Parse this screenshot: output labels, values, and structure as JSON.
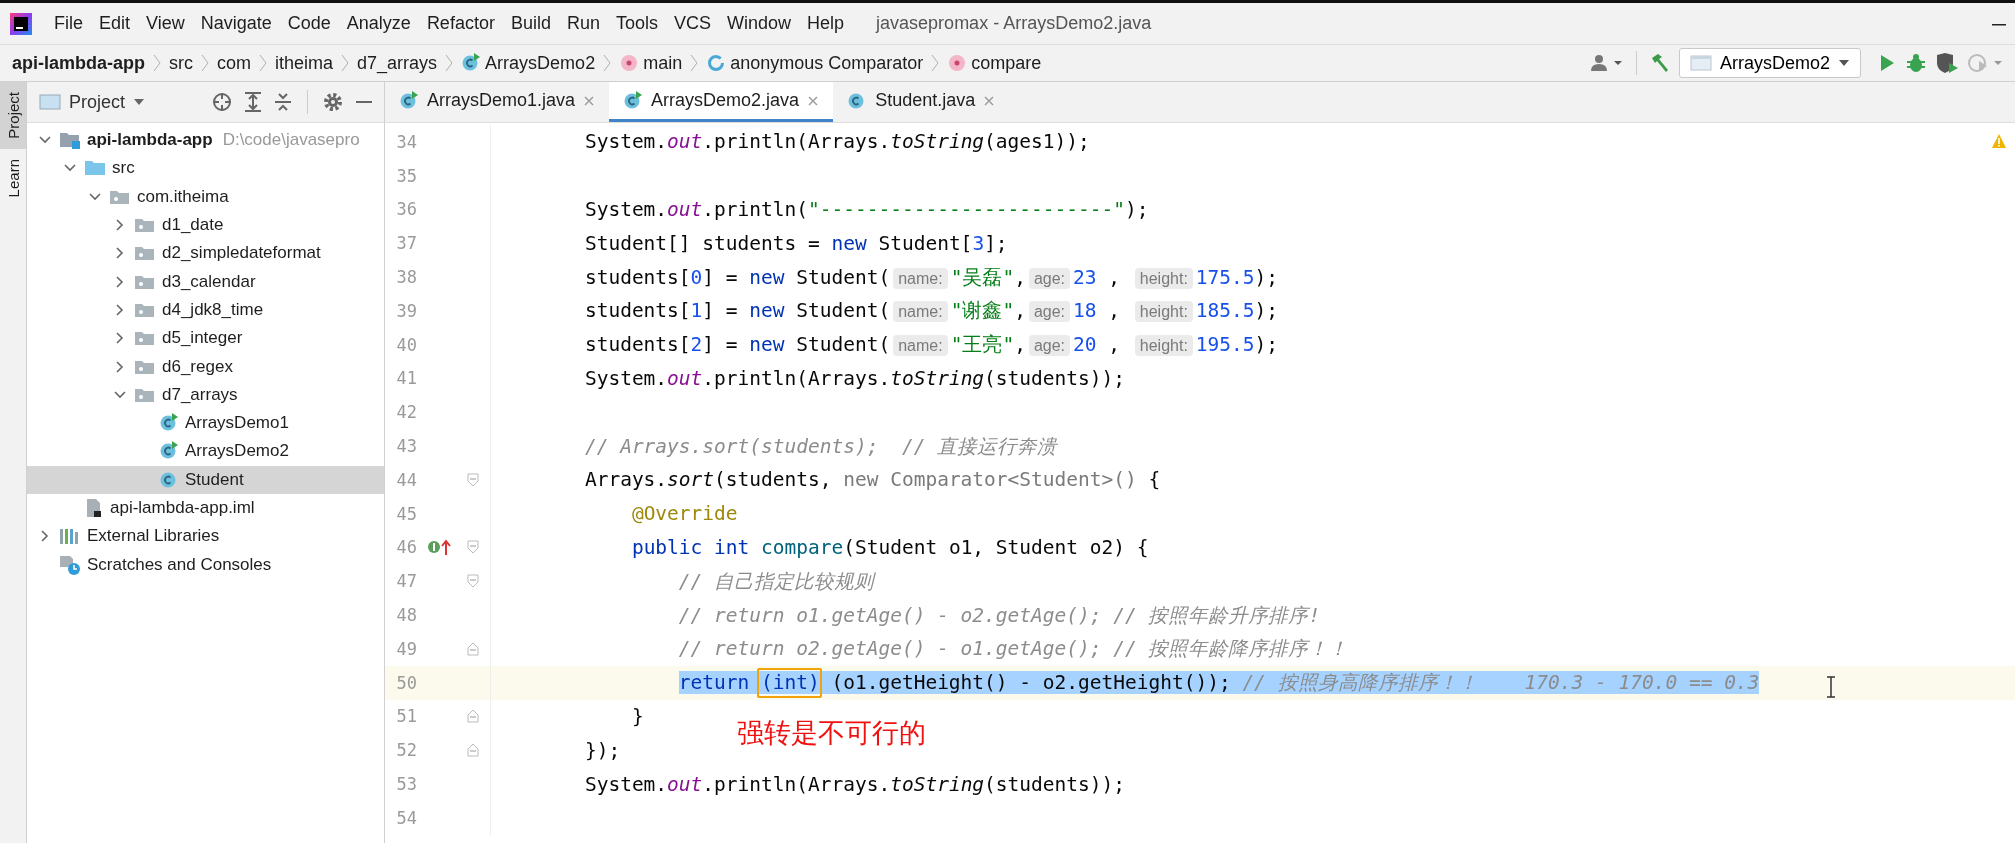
{
  "title_bar": {
    "menu": [
      "File",
      "Edit",
      "View",
      "Navigate",
      "Code",
      "Analyze",
      "Refactor",
      "Build",
      "Run",
      "Tools",
      "VCS",
      "Window",
      "Help"
    ],
    "title": "javasepromax - ArraysDemo2.java"
  },
  "nav_bar": {
    "breadcrumbs": [
      {
        "label": "api-lambda-app"
      },
      {
        "label": "src"
      },
      {
        "label": "com"
      },
      {
        "label": "itheima"
      },
      {
        "label": "d7_arrays"
      },
      {
        "label": "ArraysDemo2",
        "kind": "class-run"
      },
      {
        "label": "main",
        "kind": "method"
      },
      {
        "label": "anonymous Comparator",
        "kind": "anonymous"
      },
      {
        "label": "compare",
        "kind": "method"
      }
    ],
    "run_config": "ArraysDemo2"
  },
  "stripe_tabs": [
    {
      "label": "Project",
      "selected": true
    },
    {
      "label": "Learn",
      "selected": false
    }
  ],
  "project_panel": {
    "title": "Project",
    "tree": [
      {
        "label": "api-lambda-app",
        "kind": "module",
        "hint": "D:\\code\\javasepro",
        "expanded": true,
        "selected": false,
        "children": [
          {
            "label": "src",
            "kind": "folder-src",
            "expanded": true,
            "selected": false,
            "children": [
              {
                "label": "com.itheima",
                "kind": "package",
                "expanded": true,
                "selected": false,
                "children": [
                  {
                    "label": "d1_date",
                    "kind": "package",
                    "expanded": false,
                    "selected": false
                  },
                  {
                    "label": "d2_simpledateformat",
                    "kind": "package",
                    "expanded": false,
                    "selected": false
                  },
                  {
                    "label": "d3_calendar",
                    "kind": "package",
                    "expanded": false,
                    "selected": false
                  },
                  {
                    "label": "d4_jdk8_time",
                    "kind": "package",
                    "expanded": false,
                    "selected": false
                  },
                  {
                    "label": "d5_integer",
                    "kind": "package",
                    "expanded": false,
                    "selected": false
                  },
                  {
                    "label": "d6_regex",
                    "kind": "package",
                    "expanded": false,
                    "selected": false
                  },
                  {
                    "label": "d7_arrays",
                    "kind": "package",
                    "expanded": true,
                    "selected": false,
                    "children": [
                      {
                        "label": "ArraysDemo1",
                        "kind": "class-run",
                        "selected": false
                      },
                      {
                        "label": "ArraysDemo2",
                        "kind": "class-run",
                        "selected": false
                      },
                      {
                        "label": "Student",
                        "kind": "class",
                        "selected": true
                      }
                    ]
                  }
                ]
              }
            ]
          },
          {
            "label": "api-lambda-app.iml",
            "kind": "iml",
            "selected": false
          }
        ]
      },
      {
        "label": "External Libraries",
        "kind": "libraries",
        "expanded": false,
        "selected": false
      },
      {
        "label": "Scratches and Consoles",
        "kind": "scratches",
        "selected": false
      }
    ]
  },
  "editor": {
    "tabs": [
      {
        "label": "ArraysDemo1.java",
        "kind": "class-run",
        "selected": false
      },
      {
        "label": "ArraysDemo2.java",
        "kind": "class-run",
        "selected": true
      },
      {
        "label": "Student.java",
        "kind": "class",
        "selected": false
      }
    ],
    "lines": [
      {
        "no": "34",
        "tokens": [
          {
            "t": "        System.",
            "kind": "plain"
          },
          {
            "t": "out",
            "kind": "field"
          },
          {
            "t": ".println(Arrays.",
            "kind": "plain"
          },
          {
            "t": "toString",
            "kind": "static"
          },
          {
            "t": "(ages1));",
            "kind": "plain"
          }
        ]
      },
      {
        "no": "35"
      },
      {
        "no": "36",
        "tokens": [
          {
            "t": "        System.",
            "kind": "plain"
          },
          {
            "t": "out",
            "kind": "field"
          },
          {
            "t": ".println(",
            "kind": "plain"
          },
          {
            "t": "\"-------------------------\"",
            "kind": "string"
          },
          {
            "t": ");",
            "kind": "plain"
          }
        ]
      },
      {
        "no": "37",
        "tokens": [
          {
            "t": "        Student[] students = ",
            "kind": "plain"
          },
          {
            "t": "new",
            "kind": "keyword"
          },
          {
            "t": " Student[",
            "kind": "plain"
          },
          {
            "t": "3",
            "kind": "number"
          },
          {
            "t": "];",
            "kind": "plain"
          }
        ]
      },
      {
        "no": "38",
        "tokens": [
          {
            "t": "        students[",
            "kind": "plain"
          },
          {
            "t": "0",
            "kind": "number"
          },
          {
            "t": "] = ",
            "kind": "plain"
          },
          {
            "t": "new",
            "kind": "keyword"
          },
          {
            "t": " Student(",
            "kind": "plain"
          },
          {
            "t": "name:",
            "kind": "hint"
          },
          {
            "t": "\"吴磊\"",
            "kind": "string"
          },
          {
            "t": ",",
            "kind": "plain"
          },
          {
            "t": "age:",
            "kind": "hint"
          },
          {
            "t": "23",
            "kind": "number"
          },
          {
            "t": " , ",
            "kind": "plain"
          },
          {
            "t": "height:",
            "kind": "hint"
          },
          {
            "t": "175.5",
            "kind": "number"
          },
          {
            "t": ");",
            "kind": "plain"
          }
        ]
      },
      {
        "no": "39",
        "tokens": [
          {
            "t": "        students[",
            "kind": "plain"
          },
          {
            "t": "1",
            "kind": "number"
          },
          {
            "t": "] = ",
            "kind": "plain"
          },
          {
            "t": "new",
            "kind": "keyword"
          },
          {
            "t": " Student(",
            "kind": "plain"
          },
          {
            "t": "name:",
            "kind": "hint"
          },
          {
            "t": "\"谢鑫\"",
            "kind": "string"
          },
          {
            "t": ",",
            "kind": "plain"
          },
          {
            "t": "age:",
            "kind": "hint"
          },
          {
            "t": "18",
            "kind": "number"
          },
          {
            "t": " , ",
            "kind": "plain"
          },
          {
            "t": "height:",
            "kind": "hint"
          },
          {
            "t": "185.5",
            "kind": "number"
          },
          {
            "t": ");",
            "kind": "plain"
          }
        ]
      },
      {
        "no": "40",
        "tokens": [
          {
            "t": "        students[",
            "kind": "plain"
          },
          {
            "t": "2",
            "kind": "number"
          },
          {
            "t": "] = ",
            "kind": "plain"
          },
          {
            "t": "new",
            "kind": "keyword"
          },
          {
            "t": " Student(",
            "kind": "plain"
          },
          {
            "t": "name:",
            "kind": "hint"
          },
          {
            "t": "\"王亮\"",
            "kind": "string"
          },
          {
            "t": ",",
            "kind": "plain"
          },
          {
            "t": "age:",
            "kind": "hint"
          },
          {
            "t": "20",
            "kind": "number"
          },
          {
            "t": " , ",
            "kind": "plain"
          },
          {
            "t": "height:",
            "kind": "hint"
          },
          {
            "t": "195.5",
            "kind": "number"
          },
          {
            "t": ");",
            "kind": "plain"
          }
        ]
      },
      {
        "no": "41",
        "tokens": [
          {
            "t": "        System.",
            "kind": "plain"
          },
          {
            "t": "out",
            "kind": "field"
          },
          {
            "t": ".println(Arrays.",
            "kind": "plain"
          },
          {
            "t": "toString",
            "kind": "static"
          },
          {
            "t": "(students));",
            "kind": "plain"
          }
        ]
      },
      {
        "no": "42"
      },
      {
        "no": "43",
        "tokens": [
          {
            "t": "        // Arrays.sort(students);  // 直接运行奔溃",
            "kind": "comment"
          }
        ]
      },
      {
        "no": "44",
        "gutter": [
          {
            "kind": "fold-start"
          }
        ],
        "tokens": [
          {
            "t": "        Arrays.",
            "kind": "plain"
          },
          {
            "t": "sort",
            "kind": "static"
          },
          {
            "t": "(students, ",
            "kind": "plain"
          },
          {
            "t": "new Comparator<Student>()",
            "kind": "dim"
          },
          {
            "t": " {",
            "kind": "plain"
          }
        ]
      },
      {
        "no": "45",
        "tokens": [
          {
            "t": "            @Override",
            "kind": "annotation"
          }
        ]
      },
      {
        "no": "46",
        "gutter": [
          {
            "kind": "override"
          },
          {
            "kind": "fold-start"
          }
        ],
        "tokens": [
          {
            "t": "            public",
            "kind": "keyword"
          },
          {
            "t": " int",
            "kind": "keyword"
          },
          {
            "t": " compare",
            "kind": "method"
          },
          {
            "t": "(Student o1, Student o2) {",
            "kind": "plain"
          }
        ]
      },
      {
        "no": "47",
        "gutter": [
          {
            "kind": "fold-start"
          }
        ],
        "tokens": [
          {
            "t": "                // 自己指定比较规则",
            "kind": "comment"
          }
        ]
      },
      {
        "no": "48",
        "tokens": [
          {
            "t": "                // return o1.getAge() - o2.getAge(); // 按照年龄升序排序!",
            "kind": "comment"
          }
        ]
      },
      {
        "no": "49",
        "gutter": [
          {
            "kind": "fold-end"
          }
        ],
        "tokens": [
          {
            "t": "                // return o2.getAge() - o1.getAge(); // 按照年龄降序排序！！",
            "kind": "comment"
          }
        ]
      },
      {
        "no": "50",
        "current": true,
        "selected": true,
        "tokens": [
          {
            "t": "                return ",
            "kind": "keyword"
          },
          {
            "t": "(int)",
            "kind": "keyword",
            "boxed": true
          },
          {
            "t": " (o1.getHeight() - o2.getHeight()); ",
            "kind": "plain"
          },
          {
            "t": "// 按照身高降序排序！！    170.3 - 170.0 == 0.3",
            "kind": "comment"
          }
        ]
      },
      {
        "no": "51",
        "gutter": [
          {
            "kind": "fold-end"
          }
        ],
        "tokens": [
          {
            "t": "            }",
            "kind": "plain"
          }
        ]
      },
      {
        "no": "52",
        "gutter": [
          {
            "kind": "fold-end"
          }
        ],
        "tokens": [
          {
            "t": "        });",
            "kind": "plain"
          }
        ]
      },
      {
        "no": "53",
        "tokens": [
          {
            "t": "        System.",
            "kind": "plain"
          },
          {
            "t": "out",
            "kind": "field"
          },
          {
            "t": ".println(Arrays.",
            "kind": "plain"
          },
          {
            "t": "toString",
            "kind": "static"
          },
          {
            "t": "(students));",
            "kind": "plain"
          }
        ]
      },
      {
        "no": "54"
      }
    ],
    "note": "强转是不可行的"
  }
}
